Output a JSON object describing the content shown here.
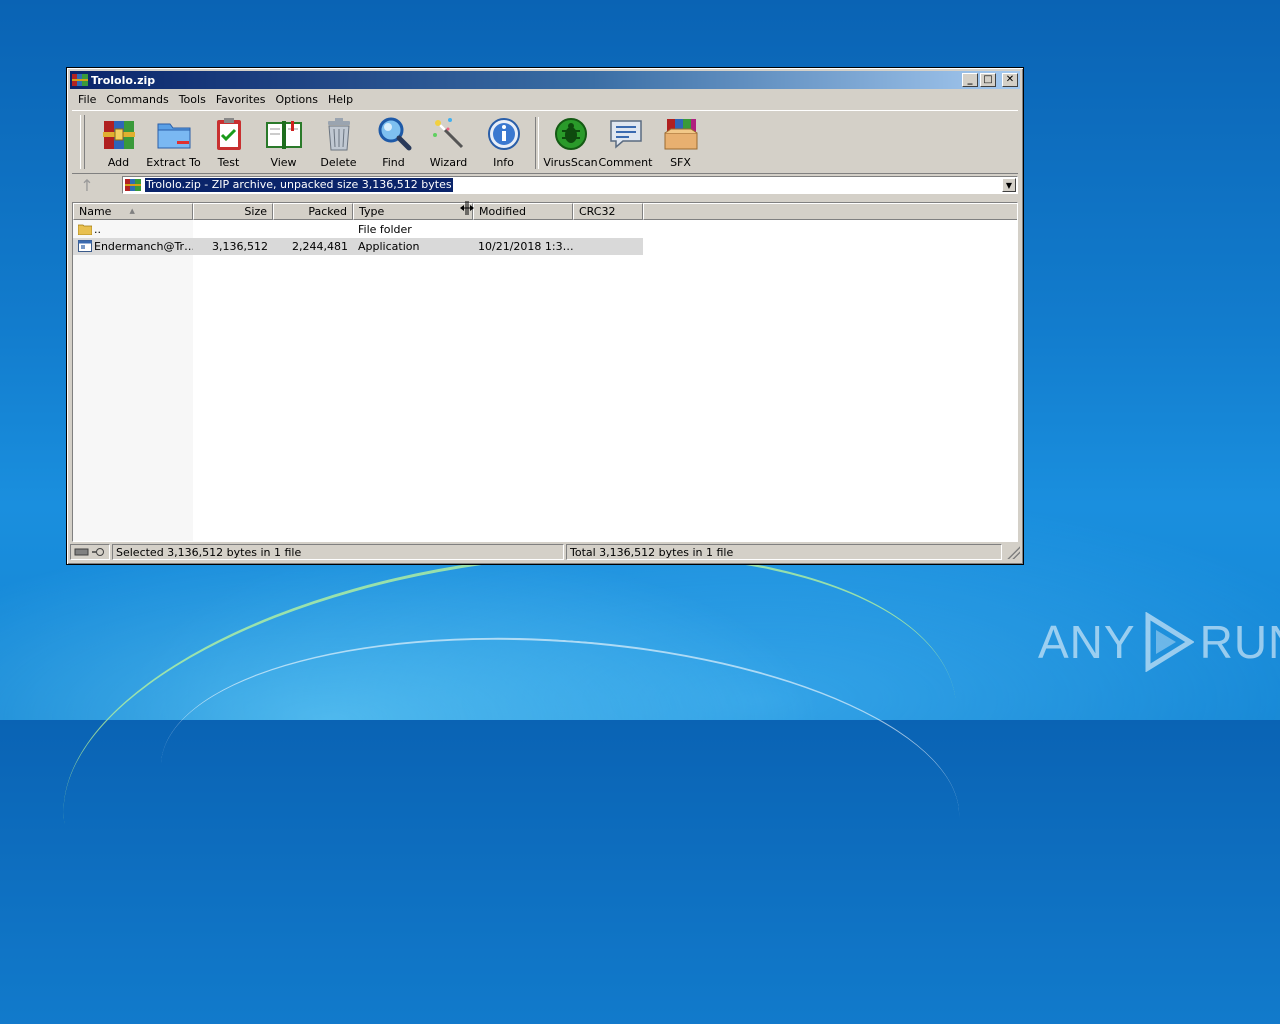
{
  "window": {
    "title": "Trololo.zip",
    "minimize": "_",
    "maximize": "□",
    "close": "✕"
  },
  "menu": [
    "File",
    "Commands",
    "Tools",
    "Favorites",
    "Options",
    "Help"
  ],
  "toolbar": {
    "buttons": [
      {
        "label": "Add",
        "icon": "archive-books-icon"
      },
      {
        "label": "Extract To",
        "icon": "folder-icon"
      },
      {
        "label": "Test",
        "icon": "clipboard-check-icon"
      },
      {
        "label": "View",
        "icon": "open-book-icon"
      },
      {
        "label": "Delete",
        "icon": "trash-can-icon"
      },
      {
        "label": "Find",
        "icon": "magnifier-icon"
      },
      {
        "label": "Wizard",
        "icon": "magic-wand-icon"
      },
      {
        "label": "Info",
        "icon": "info-icon"
      },
      {
        "label": "VirusScan",
        "icon": "bug-scan-icon"
      },
      {
        "label": "Comment",
        "icon": "comment-icon"
      },
      {
        "label": "SFX",
        "icon": "sfx-box-icon"
      }
    ]
  },
  "address": {
    "text": "Trololo.zip - ZIP archive, unpacked size 3,136,512 bytes"
  },
  "columns": {
    "name": "Name",
    "size": "Size",
    "packed": "Packed",
    "type": "Type",
    "modified": "Modified",
    "crc": "CRC32"
  },
  "rows": [
    {
      "name": "..",
      "size": "",
      "packed": "",
      "type": "File folder",
      "modified": "",
      "crc": ""
    },
    {
      "name": "Endermanch@Tr…",
      "size": "3,136,512",
      "packed": "2,244,481",
      "type": "Application",
      "modified": "10/21/2018 1:3…",
      "crc": ""
    }
  ],
  "status": {
    "left": "Selected 3,136,512 bytes in 1 file",
    "right": "Total 3,136,512 bytes in 1 file"
  },
  "watermark": {
    "left": "ANY",
    "right": "RUN"
  },
  "colors": {
    "titlebar_start": "#0a246a",
    "selection": "#0a246a",
    "window_face": "#d4d0c8"
  }
}
